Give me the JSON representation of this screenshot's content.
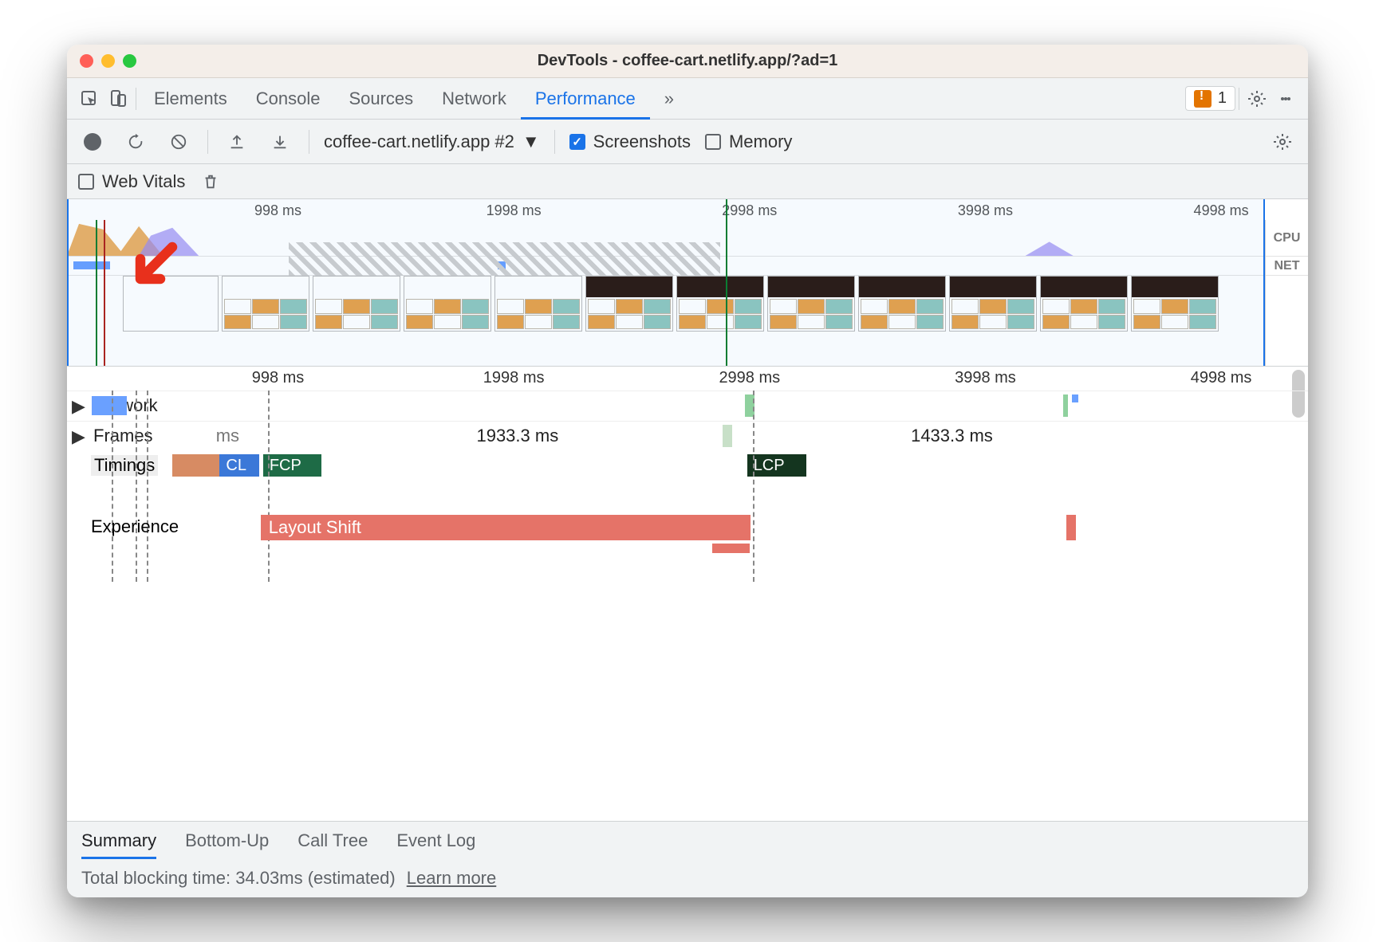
{
  "window": {
    "title": "DevTools - coffee-cart.netlify.app/?ad=1"
  },
  "tabs": {
    "items": [
      "Elements",
      "Console",
      "Sources",
      "Network",
      "Performance"
    ],
    "active_index": 4,
    "overflow_glyph": "»",
    "issues_count": "1"
  },
  "perf_toolbar": {
    "profile_selector": "coffee-cart.netlify.app #2",
    "screenshots_label": "Screenshots",
    "screenshots_checked": true,
    "memory_label": "Memory",
    "memory_checked": false
  },
  "vitals_bar": {
    "web_vitals_label": "Web Vitals",
    "web_vitals_checked": false
  },
  "overview": {
    "lane_labels": {
      "cpu": "CPU",
      "net": "NET"
    },
    "ruler_ticks": [
      {
        "label": "998 ms",
        "pct": 17
      },
      {
        "label": "1998 ms",
        "pct": 36
      },
      {
        "label": "2998 ms",
        "pct": 55
      },
      {
        "label": "3998 ms",
        "pct": 74
      },
      {
        "label": "4998 ms",
        "pct": 93
      }
    ]
  },
  "main": {
    "ruler_ticks": [
      {
        "label": "998 ms",
        "pct": 17
      },
      {
        "label": "1998 ms",
        "pct": 36
      },
      {
        "label": "2998 ms",
        "pct": 55
      },
      {
        "label": "3998 ms",
        "pct": 74
      },
      {
        "label": "4998 ms",
        "pct": 93
      }
    ],
    "tracks": {
      "network": "Network",
      "frames": "Frames",
      "frames_values": [
        {
          "label": "ms",
          "pct": 12
        },
        {
          "label": "1933.3 ms",
          "pct": 33
        },
        {
          "label": "1433.3 ms",
          "pct": 68
        }
      ],
      "timings": {
        "name": "Timings",
        "markers": [
          {
            "label": "CL",
            "color": "#3b78d8",
            "left_pct": 12.4,
            "width_pct": 2.6
          },
          {
            "label": "FCP",
            "color": "#1e6b46",
            "left_pct": 15.6,
            "width_pct": 4.7
          },
          {
            "label": "LCP",
            "color": "#14351f",
            "left_pct": 54.8,
            "width_pct": 4.8
          }
        ]
      },
      "experience": {
        "name": "Experience",
        "bars": [
          {
            "label": "Layout Shift",
            "left_pct": 15.6,
            "width_pct": 39.5
          },
          {
            "label": "",
            "left_pct": 80.5,
            "width_pct": 0.8
          }
        ],
        "sub_bars": [
          {
            "left_pct": 52.0,
            "width_pct": 3.0
          }
        ]
      }
    }
  },
  "footer_tabs": {
    "items": [
      "Summary",
      "Bottom-Up",
      "Call Tree",
      "Event Log"
    ],
    "active_index": 0
  },
  "footer_info": {
    "text": "Total blocking time: 34.03ms (estimated)",
    "learn_more": "Learn more"
  }
}
